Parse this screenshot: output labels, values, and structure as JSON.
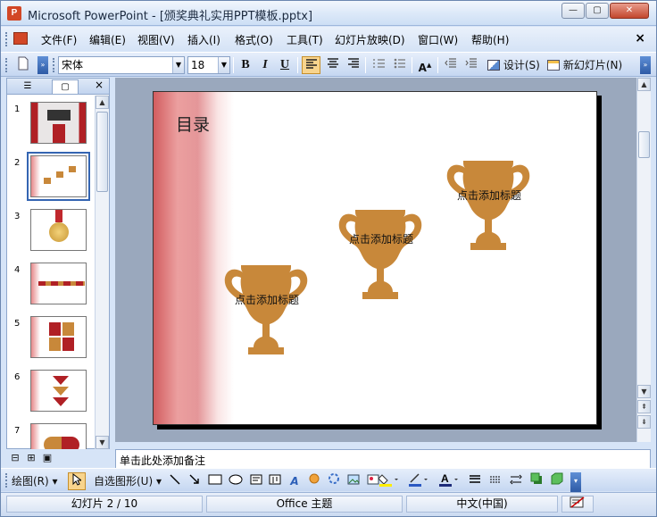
{
  "window": {
    "app_icon": "P",
    "title": "Microsoft PowerPoint - [颁奖典礼实用PPT模板.pptx]",
    "minimize_label": "—",
    "restore_label": "▢",
    "close_label": "✕"
  },
  "menubar": {
    "items": [
      "文件(F)",
      "编辑(E)",
      "视图(V)",
      "插入(I)",
      "格式(O)",
      "工具(T)",
      "幻灯片放映(D)",
      "窗口(W)",
      "帮助(H)"
    ],
    "doc_close": "×"
  },
  "toolbar": {
    "font_name": "宋体",
    "font_size": "18",
    "bold": "B",
    "italic": "I",
    "underline": "U",
    "design_label": "设计(S)",
    "new_slide_label": "新幻灯片(N)"
  },
  "left_pane": {
    "close": "×",
    "slide_numbers": [
      "1",
      "2",
      "3",
      "4",
      "5",
      "6",
      "7"
    ],
    "current_slide": 2
  },
  "slide": {
    "title": "目录",
    "trophy_labels": [
      "点击添加标题",
      "点击添加标题",
      "点击添加标题"
    ],
    "trophy_color": "#c8883a"
  },
  "notes": {
    "placeholder": "单击此处添加备注"
  },
  "drawbar": {
    "draw_label": "绘图(R)",
    "autoshapes_label": "自选图形(U)"
  },
  "status": {
    "slide_info": "幻灯片 2 / 10",
    "theme": "Office 主题",
    "language": "中文(中国)"
  }
}
